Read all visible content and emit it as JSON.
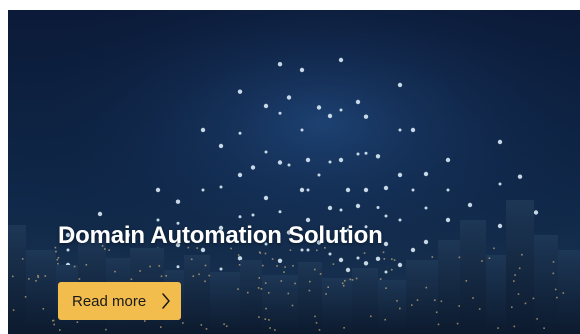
{
  "hero": {
    "title": "Domain Automation Solution",
    "button_label": "Read more",
    "button_icon": "chevron-right-icon",
    "background_image": "city-skyline-light-streaks"
  },
  "colors": {
    "hero_background": "#0a1a36",
    "button_background": "#f2bd4c",
    "title_text": "#ffffff",
    "button_text": "#1a1a1a"
  }
}
